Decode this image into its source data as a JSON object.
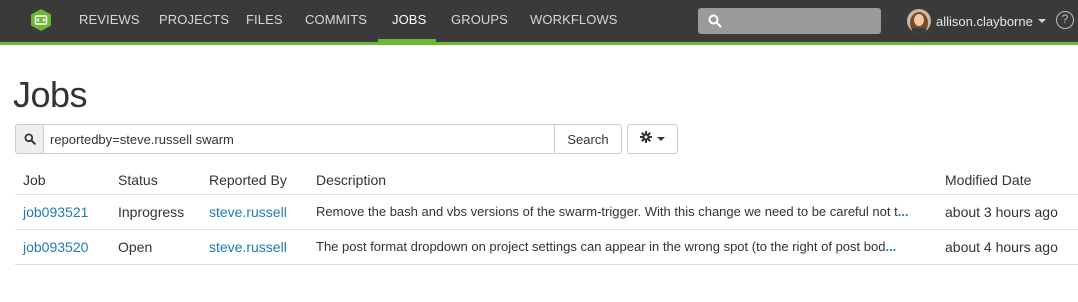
{
  "nav": {
    "items": [
      {
        "label": "REVIEWS"
      },
      {
        "label": "PROJECTS"
      },
      {
        "label": "FILES"
      },
      {
        "label": "COMMITS"
      },
      {
        "label": "JOBS",
        "active": true
      },
      {
        "label": "GROUPS"
      },
      {
        "label": "WORKFLOWS"
      }
    ],
    "search_placeholder": "",
    "user": {
      "name": "allison.clayborne"
    },
    "help_label": "?"
  },
  "page": {
    "title": "Jobs"
  },
  "search": {
    "query": "reportedby=steve.russell swarm",
    "button_label": "Search"
  },
  "table": {
    "headers": [
      "Job",
      "Status",
      "Reported By",
      "Description",
      "Modified Date"
    ],
    "rows": [
      {
        "job": "job093521",
        "status": "Inprogress",
        "reported_by": "steve.russell",
        "description": "Remove the bash and vbs versions of the swarm-trigger. With this change we need to be careful not t",
        "more": "...",
        "modified": "about 3 hours ago"
      },
      {
        "job": "job093520",
        "status": "Open",
        "reported_by": "steve.russell",
        "description": "The post format dropdown on project settings can appear in the wrong spot (to the right of post bod",
        "more": "...",
        "modified": "about 4 hours ago"
      }
    ]
  },
  "colors": {
    "navbar_bg": "#3a3a3a",
    "accent_green": "#6fb634",
    "link_blue": "#1e7ab8"
  },
  "icons": [
    "swarm-logo-icon",
    "search-icon",
    "gear-icon",
    "caret-down-icon",
    "help-icon"
  ]
}
